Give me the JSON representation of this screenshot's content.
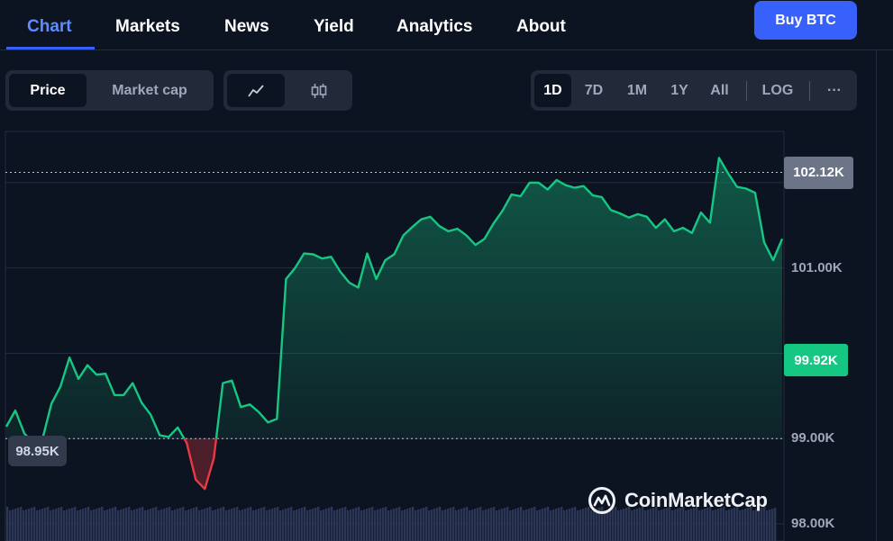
{
  "nav": {
    "tabs": [
      {
        "label": "Chart",
        "active": true
      },
      {
        "label": "Markets"
      },
      {
        "label": "News"
      },
      {
        "label": "Yield"
      },
      {
        "label": "Analytics"
      },
      {
        "label": "About"
      }
    ],
    "buy_label": "Buy BTC"
  },
  "toolbar": {
    "metric_tabs": [
      {
        "label": "Price",
        "active": true
      },
      {
        "label": "Market cap"
      }
    ],
    "chart_types": [
      {
        "icon": "line-chart-icon",
        "active": true
      },
      {
        "icon": "candlestick-icon"
      }
    ],
    "ranges": [
      {
        "label": "1D",
        "active": true
      },
      {
        "label": "7D"
      },
      {
        "label": "1M"
      },
      {
        "label": "1Y"
      },
      {
        "label": "All"
      }
    ],
    "log_label": "LOG",
    "more_label": "···"
  },
  "watermark": "CoinMarketCap",
  "colors": {
    "background": "#0d1421",
    "accent": "#3861fb",
    "up_line": "#16c784",
    "down_line": "#ea3943",
    "grid": "#222d3e",
    "volume": "#2b3656",
    "high_tag": "#6b7587"
  },
  "chart_data": {
    "type": "line",
    "reference_price": 99.0,
    "ylim": [
      97.8,
      102.6
    ],
    "yticks": [
      98.0,
      99.0,
      101.0
    ],
    "ytick_labels": [
      "98.00K",
      "99.00K",
      "101.00K"
    ],
    "current_price": 99.92,
    "current_label": "99.92K",
    "high_price": 102.12,
    "high_label": "102.12K",
    "low_price": 98.95,
    "low_label": "98.95K",
    "grid": true,
    "values": [
      99.14,
      99.33,
      99.06,
      98.95,
      98.99,
      99.41,
      99.61,
      99.95,
      99.7,
      99.86,
      99.75,
      99.76,
      99.51,
      99.51,
      99.65,
      99.42,
      99.28,
      99.04,
      99.02,
      99.13,
      98.95,
      98.52,
      98.41,
      98.77,
      99.65,
      99.68,
      99.37,
      99.4,
      99.31,
      99.19,
      99.23,
      100.87,
      101.0,
      101.17,
      101.16,
      101.11,
      101.13,
      100.96,
      100.83,
      100.77,
      101.17,
      100.87,
      101.09,
      101.16,
      101.38,
      101.48,
      101.57,
      101.6,
      101.49,
      101.43,
      101.46,
      101.38,
      101.27,
      101.34,
      101.52,
      101.67,
      101.86,
      101.84,
      102.0,
      102.0,
      101.92,
      102.03,
      101.97,
      101.94,
      101.96,
      101.85,
      101.83,
      101.68,
      101.64,
      101.59,
      101.63,
      101.6,
      101.47,
      101.57,
      101.43,
      101.47,
      101.41,
      101.65,
      101.53,
      102.29,
      102.11,
      101.95,
      101.93,
      101.88,
      101.3,
      101.09,
      101.34
    ]
  }
}
